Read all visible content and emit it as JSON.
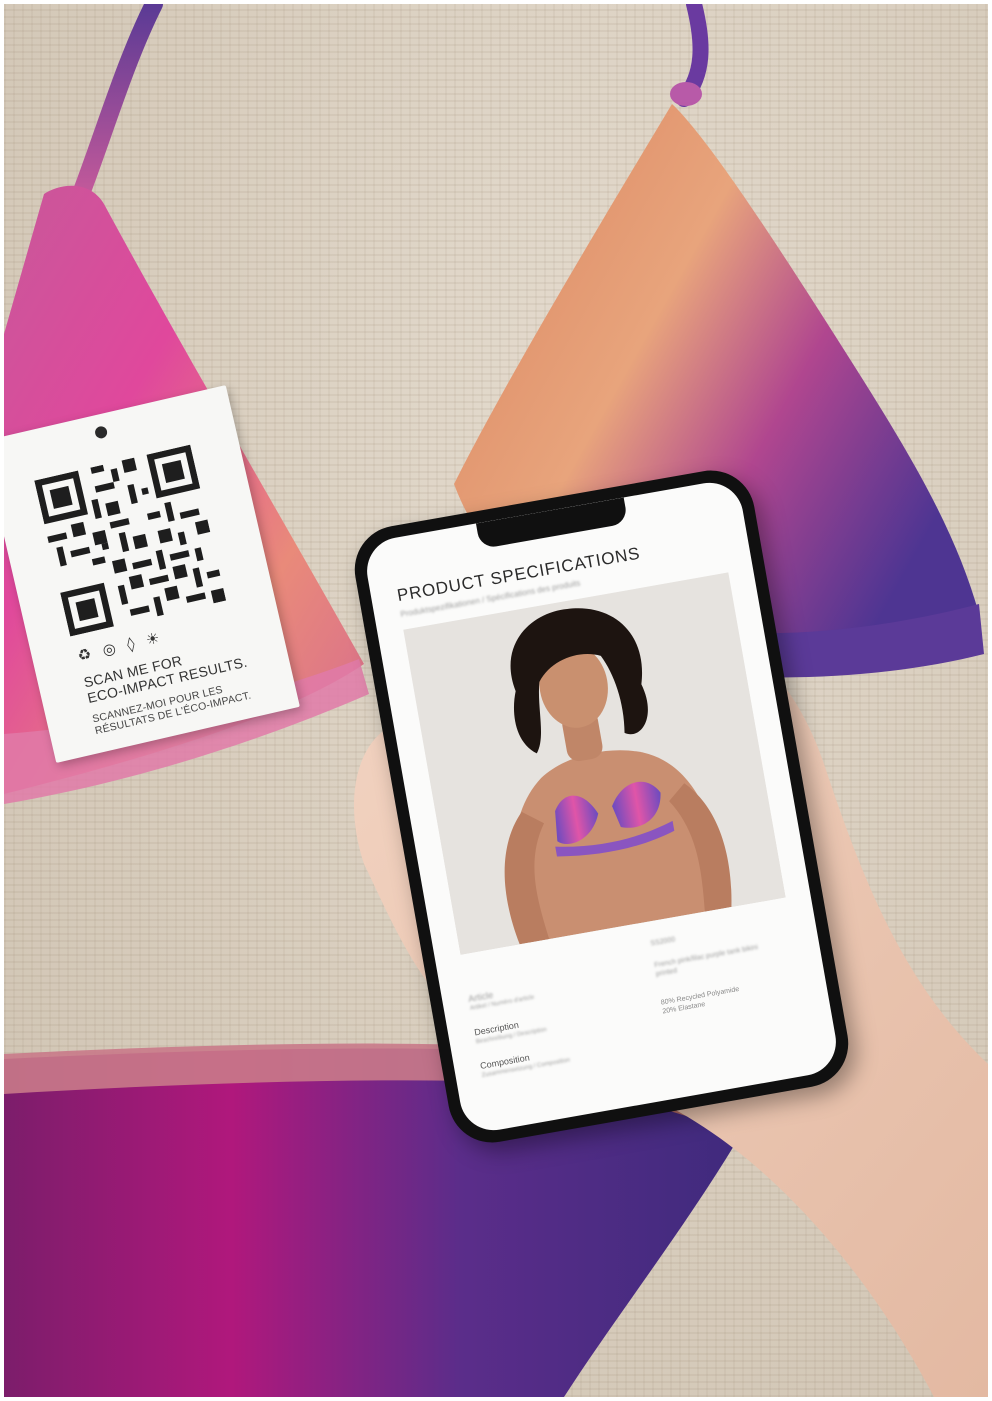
{
  "tag": {
    "icons": [
      "recycle-icon",
      "fish-icon",
      "water-drop-icon",
      "sun-icon"
    ],
    "icon_glyphs": [
      "♻",
      "◎",
      "◊",
      "☀"
    ],
    "line1": "SCAN ME FOR\nECO-IMPACT RESULTS.",
    "line2": "SCANNEZ-MOI POUR LES\nRÉSULTATS DE L'ÉCO-IMPACT."
  },
  "screen": {
    "title": "PRODUCT SPECIFICATIONS",
    "specs": [
      {
        "label": "Description"
      },
      {
        "label": "Composition"
      }
    ],
    "composition_value": "80% Recycled Polyamide\n20% Elastane"
  },
  "colors": {
    "bikini_pink": "#e0489c",
    "bikini_orange": "#e39a74",
    "bikini_purple": "#5a3a95",
    "bottom_magenta": "#a3197a"
  }
}
